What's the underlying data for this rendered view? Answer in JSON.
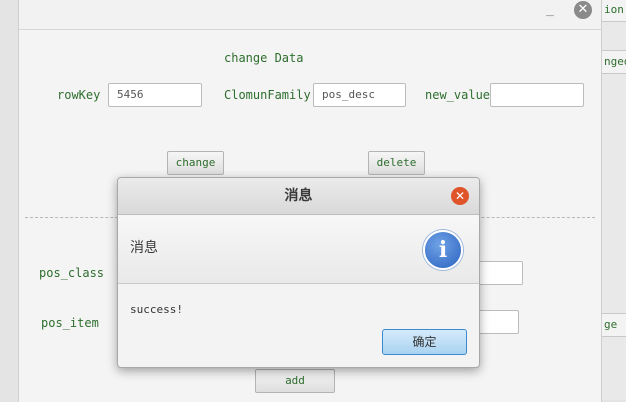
{
  "behind_window": {
    "frag1": "ion",
    "frag2": "nged",
    "frag3": "ge"
  },
  "window": {
    "minimize_glyph": "_",
    "close_glyph": "✕"
  },
  "change_section": {
    "heading": "change Data",
    "rowkey_label": "rowKey",
    "rowkey_value": "5456",
    "column_family_label": "ClomunFamily",
    "column_family_value": "pos_desc",
    "new_value_label": "new_value",
    "new_value_value": "",
    "change_button": "change",
    "delete_button": "delete"
  },
  "add_section": {
    "pos_class_label": "pos_class",
    "pos_item_label": "pos_item",
    "add_button": "add"
  },
  "dialog": {
    "title": "消息",
    "close_glyph": "✕",
    "header_text": "消息",
    "info_glyph": "i",
    "message": "success!",
    "ok_button": "确定"
  }
}
